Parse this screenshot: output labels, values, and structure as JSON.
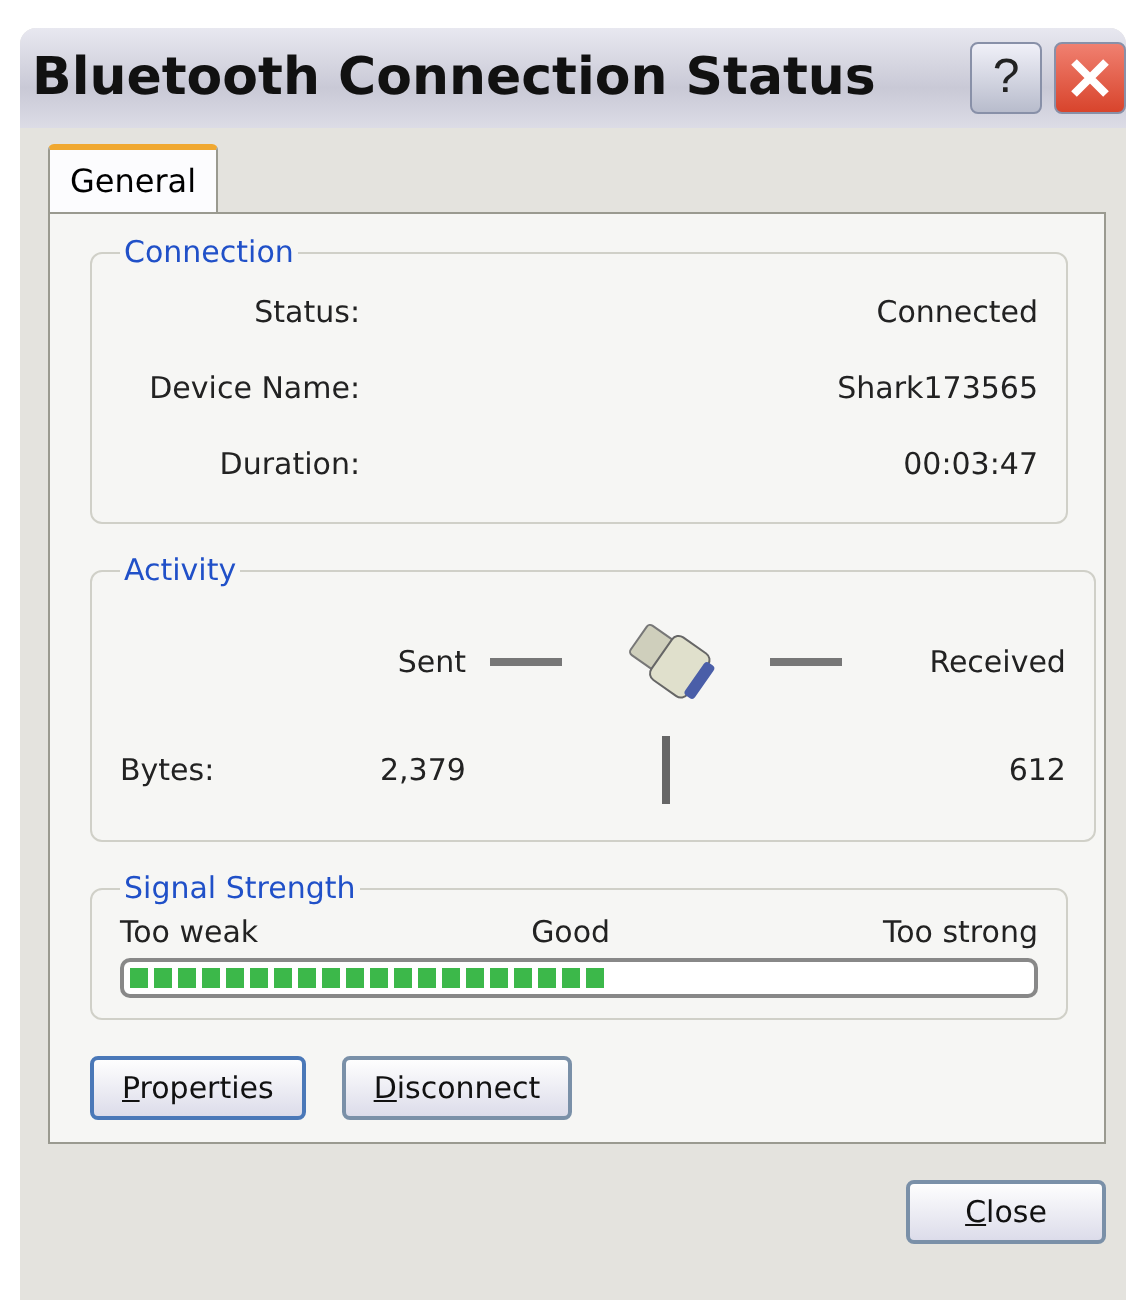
{
  "window": {
    "title": "Bluetooth Connection Status",
    "help_button": "?"
  },
  "tabs": [
    {
      "label": "General",
      "selected": true
    }
  ],
  "connection": {
    "title": "Connection",
    "rows": [
      {
        "label": "Status:",
        "value": "Connected"
      },
      {
        "label": "Device Name:",
        "value": "Shark173565"
      },
      {
        "label": "Duration:",
        "value": "00:03:47"
      }
    ]
  },
  "activity": {
    "title": "Activity",
    "sent_label": "Sent",
    "received_label": "Received",
    "bytes_label": "Bytes:",
    "bytes_sent": "2,379",
    "bytes_received": "612"
  },
  "signal": {
    "title": "Signal Strength",
    "scale": [
      "Too weak",
      "Good",
      "Too strong"
    ],
    "level": 0.53
  },
  "actions": [
    "Properties",
    "Disconnect"
  ],
  "footer_buttons": [
    "Close"
  ]
}
